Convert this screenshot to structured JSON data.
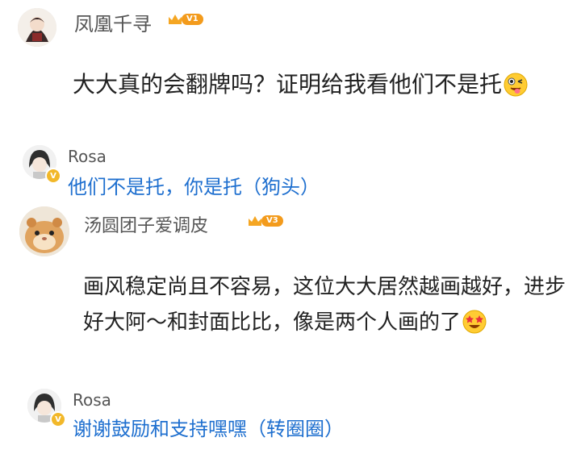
{
  "comments": [
    {
      "user": "凤凰千寻",
      "level": "V1",
      "text": "大大真的会翻牌吗？证明给我看他们不是托",
      "reply": {
        "user": "Rosa",
        "text": "他们不是托，你是托（狗头）"
      }
    },
    {
      "user": "汤圆团子爱调皮",
      "level": "V3",
      "text": "画风稳定尚且不容易，这位大大居然越画越好，进步好大阿～和封面比比，像是两个人画的了",
      "reply": {
        "user": "Rosa",
        "text": "谢谢鼓励和支持嘿嘿（转圈圈）"
      }
    }
  ],
  "colors": {
    "reply_text": "#1e6fcf",
    "badge": "#f39b1c",
    "v_mark": "#f2b82a"
  },
  "icons": [
    "crown-icon",
    "winking-tongue-emoji-icon",
    "star-struck-emoji-icon",
    "verified-v-icon"
  ]
}
